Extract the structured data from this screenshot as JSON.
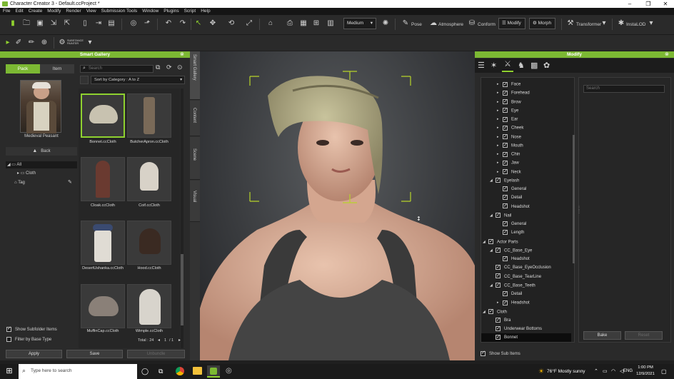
{
  "window": {
    "title": "Character Creator 3 - Default.ccProject *"
  },
  "menu": [
    "File",
    "Edit",
    "Create",
    "Modify",
    "Render",
    "View",
    "Submission Tools",
    "Window",
    "Plugins",
    "Script",
    "Help"
  ],
  "toolbar": {
    "quality_select": "Medium",
    "pose_label": "Pose",
    "atmosphere_label": "Atmosphere",
    "conform_label": "Conform",
    "modify_label": "Modify",
    "morph_label": "Morph",
    "transformer_label": "Transformer",
    "instalod_label": "InstaLOD",
    "substance_label": "SUBSTANCE PAINTER"
  },
  "smart_gallery": {
    "title": "Smart Gallery",
    "tabs": [
      "Pack",
      "Item"
    ],
    "active_tab": "Pack",
    "preview_label": "Medieval Peasant",
    "back_label": "Back",
    "tree": [
      {
        "label": "All",
        "level": 0,
        "selected": true
      },
      {
        "label": "Cloth",
        "level": 1
      },
      {
        "label": "Tag",
        "level": 0
      }
    ],
    "search_placeholder": "Search",
    "sort_label": "Sort by Category : A to Z",
    "items": [
      {
        "label": "Bonnet.ccCloth",
        "selected": true
      },
      {
        "label": "ButcherApron.ccCloth"
      },
      {
        "label": "Cloak.ccCloth"
      },
      {
        "label": "Coif.ccCloth"
      },
      {
        "label": "DesertUshanka.ccCloth"
      },
      {
        "label": "Hood.ccCloth"
      },
      {
        "label": "MuffinCap.ccCloth"
      },
      {
        "label": "Wimple.ccCloth"
      }
    ],
    "show_subfolder_label": "Show Subfolder Items",
    "filter_base_label": "Filter by Base Type",
    "total_label": "Total : 24",
    "page_current": "1",
    "page_total": "/ 1",
    "apply_label": "Apply",
    "save_label": "Save",
    "unbundle_label": "Unbundle"
  },
  "vertical_tabs": [
    "Smart Gallery",
    "Content",
    "Scene",
    "Visual"
  ],
  "modify": {
    "title": "Modify",
    "search_placeholder": "Search",
    "tree": [
      {
        "label": "Face",
        "level": 2,
        "arrow": "▸"
      },
      {
        "label": "Forehead",
        "level": 2,
        "arrow": "▸"
      },
      {
        "label": "Brow",
        "level": 2,
        "arrow": "▸"
      },
      {
        "label": "Eye",
        "level": 2,
        "arrow": "▸"
      },
      {
        "label": "Ear",
        "level": 2,
        "arrow": "▸"
      },
      {
        "label": "Cheek",
        "level": 2,
        "arrow": "▸"
      },
      {
        "label": "Nose",
        "level": 2,
        "arrow": "▸"
      },
      {
        "label": "Mouth",
        "level": 2,
        "arrow": "▸"
      },
      {
        "label": "Chin",
        "level": 2,
        "arrow": "▸"
      },
      {
        "label": "Jaw",
        "level": 2,
        "arrow": "▸"
      },
      {
        "label": "Neck",
        "level": 2,
        "arrow": "▸"
      },
      {
        "label": "Eyelash",
        "level": 1,
        "arrow": "◢"
      },
      {
        "label": "General",
        "level": 2,
        "arrow": ""
      },
      {
        "label": "Detail",
        "level": 2,
        "arrow": ""
      },
      {
        "label": "Headshot",
        "level": 2,
        "arrow": ""
      },
      {
        "label": "Nail",
        "level": 1,
        "arrow": "◢"
      },
      {
        "label": "General",
        "level": 2,
        "arrow": ""
      },
      {
        "label": "Length",
        "level": 2,
        "arrow": ""
      },
      {
        "label": "Actor Parts",
        "level": 0,
        "arrow": "◢"
      },
      {
        "label": "CC_Base_Eye",
        "level": 1,
        "arrow": "◢"
      },
      {
        "label": "Headshot",
        "level": 2,
        "arrow": ""
      },
      {
        "label": "CC_Base_EyeOcclusion",
        "level": 1,
        "arrow": ""
      },
      {
        "label": "CC_Base_TearLine",
        "level": 1,
        "arrow": ""
      },
      {
        "label": "CC_Base_Teeth",
        "level": 1,
        "arrow": "◢"
      },
      {
        "label": "Detail",
        "level": 2,
        "arrow": ""
      },
      {
        "label": "Headshot",
        "level": 2,
        "arrow": "▸"
      },
      {
        "label": "Cloth",
        "level": 0,
        "arrow": "◢"
      },
      {
        "label": "Bra",
        "level": 1,
        "arrow": ""
      },
      {
        "label": "Underwear Bottoms",
        "level": 1,
        "arrow": ""
      },
      {
        "label": "Bonnet",
        "level": 1,
        "arrow": "",
        "selected": true
      }
    ],
    "bake_label": "Bake",
    "reset_label": "Reset",
    "show_sub_items_label": "Show Sub Items"
  },
  "taskbar": {
    "search_placeholder": "Type here to search",
    "weather": "76°F  Mostly sunny",
    "lang": "ENG",
    "time": "1:00 PM",
    "date": "12/9/2021"
  },
  "colors": {
    "accent": "#7cb833",
    "panel": "#2a2a2a",
    "selection": "#8fd12f"
  }
}
